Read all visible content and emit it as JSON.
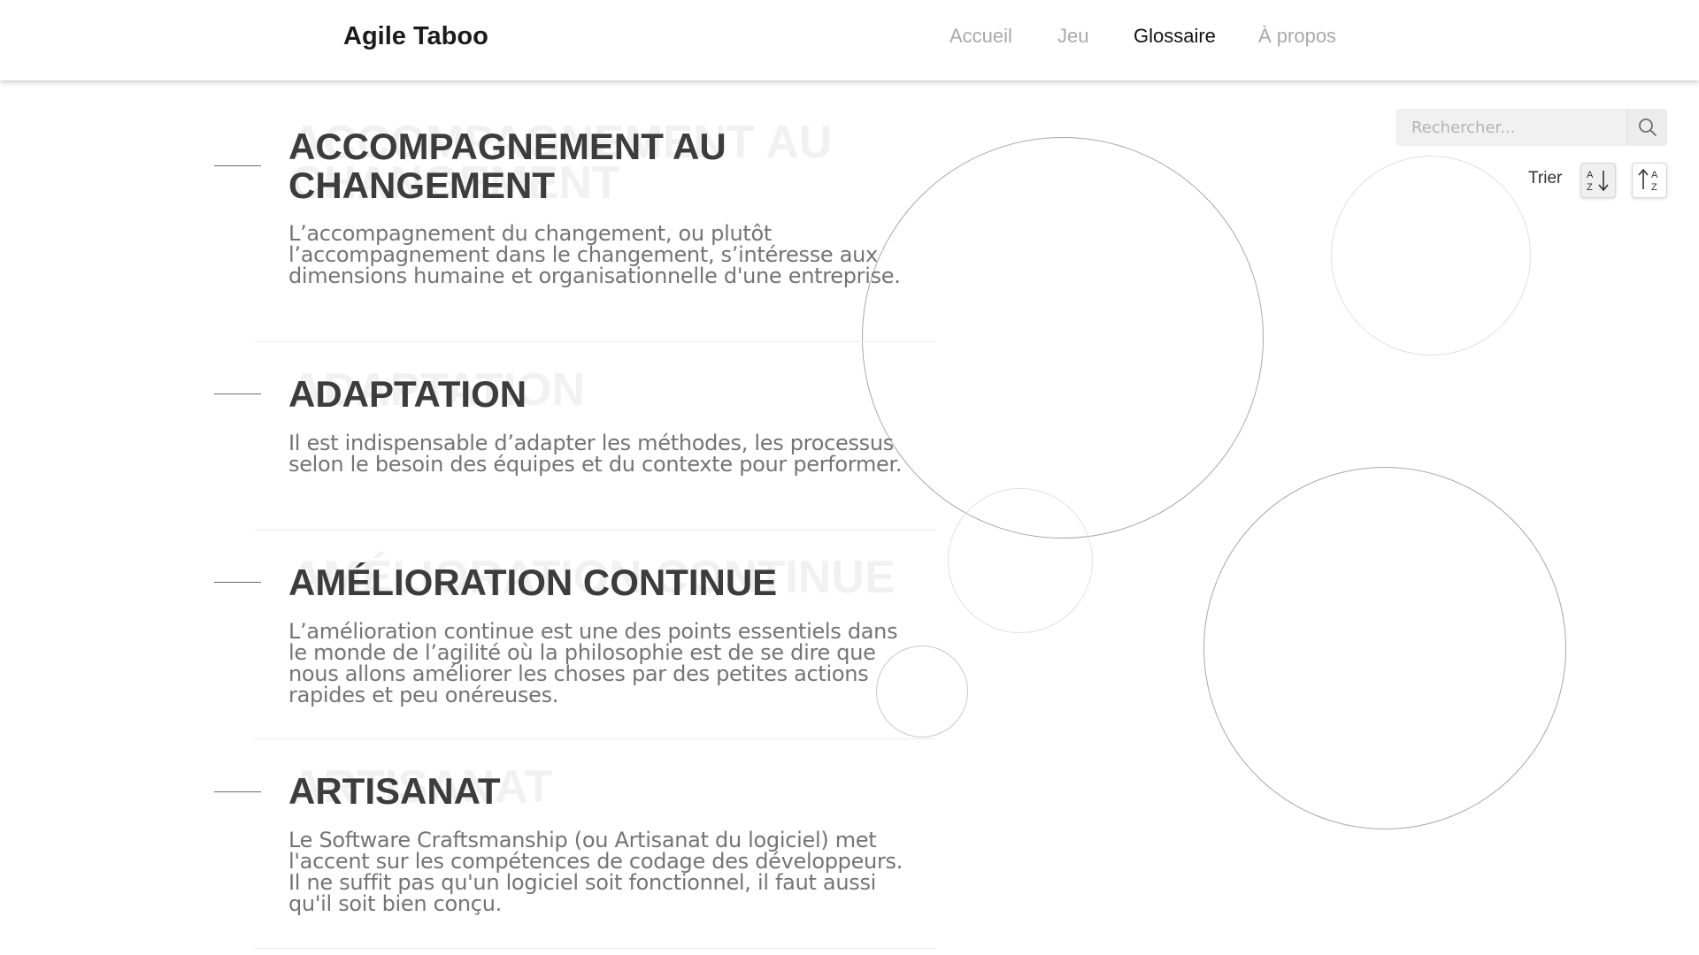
{
  "header": {
    "brand": "Agile Taboo",
    "nav": [
      {
        "label": "Accueil",
        "active": false
      },
      {
        "label": "Jeu",
        "active": false
      },
      {
        "label": "Glossaire",
        "active": true
      },
      {
        "label": "À propos",
        "active": false
      }
    ]
  },
  "search": {
    "placeholder": "Rechercher...",
    "icon": "search-icon"
  },
  "sort": {
    "label": "Trier",
    "asc_icon": "sort-az-down-icon",
    "desc_icon": "sort-az-up-icon"
  },
  "glossary": [
    {
      "term": "ACCOMPAGNEMENT AU CHANGEMENT",
      "description": "L’accompagnement du changement, ou plutôt l’accompagnement dans le changement, s’intéresse aux dimensions humaine et organisationnelle d'une entreprise."
    },
    {
      "term": "ADAPTATION",
      "description": "Il est indispensable d’adapter les méthodes, les processus selon le besoin des équipes et du contexte pour performer."
    },
    {
      "term": "AMÉLIORATION CONTINUE",
      "description": "L’amélioration continue est une des points essentiels dans le monde de l’agilité où la philosophie est de se dire que nous allons améliorer les choses par des petites actions rapides et peu onéreuses."
    },
    {
      "term": "ARTISANAT",
      "description": "Le Software Craftsmanship (ou Artisanat du logiciel) met l'accent sur les compétences de codage des développeurs. Il ne suffit pas qu'un logiciel soit fonctionnel, il faut aussi qu'il soit bien conçu."
    }
  ],
  "colors": {
    "accent_text": "#3c3c3c",
    "nav_inactive": "#a9a9a9",
    "nav_active": "#111111"
  }
}
